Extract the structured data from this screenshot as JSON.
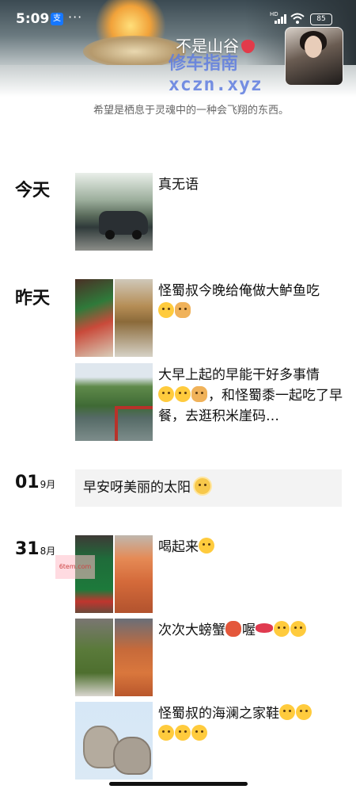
{
  "status_bar": {
    "time": "5:09",
    "more": "···",
    "network": "HD",
    "battery": "85",
    "alipay_glyph": "支"
  },
  "profile": {
    "nickname": "不是山谷",
    "signature": "希望是栖息于灵魂中的一种会飞翔的东西。"
  },
  "watermark": {
    "line1": "修车指南",
    "line2": "xczn.xyz"
  },
  "moments": [
    {
      "date": "今天",
      "text": "真无语",
      "photos": [
        "car-photo"
      ]
    },
    {
      "date": "昨天",
      "text": "怪蜀叔今晚给俺做大鲈鱼吃",
      "photos": [
        "dinner-photo-1",
        "fish-photo"
      ]
    },
    {
      "date": "",
      "text": "大早上起的早能干好多事情",
      "text2": "，和怪蜀黍一起吃了早餐，去逛积米崖码…",
      "photos": [
        "hill-lake-photo"
      ]
    },
    {
      "day": "01",
      "month": "9月",
      "text": "早安呀美丽的太阳"
    },
    {
      "day": "31",
      "month": "8月",
      "text": "喝起来",
      "photos": [
        "beer-photo",
        "shrimp-photo"
      ]
    },
    {
      "date": "",
      "text": "次次大螃蟹",
      "text_mid": "喔",
      "photos": [
        "vegetables-photo",
        "crab-photo"
      ]
    },
    {
      "date": "",
      "text": "怪蜀叔的海澜之家鞋",
      "photos": [
        "shoes-photo"
      ]
    }
  ],
  "stamp_text": "6tem.com",
  "icons": {
    "emoji_grin": "grinning-emoji-icon",
    "emoji_dog": "doge-emoji-icon",
    "emoji_crab": "crab-emoji-icon",
    "emoji_lips": "lips-emoji-icon",
    "emoji_sun": "sun-face-emoji-icon",
    "strawberry": "strawberry-icon"
  },
  "colors": {
    "watermark": "#5f7de0",
    "card_bg": "#f3f3f3"
  }
}
